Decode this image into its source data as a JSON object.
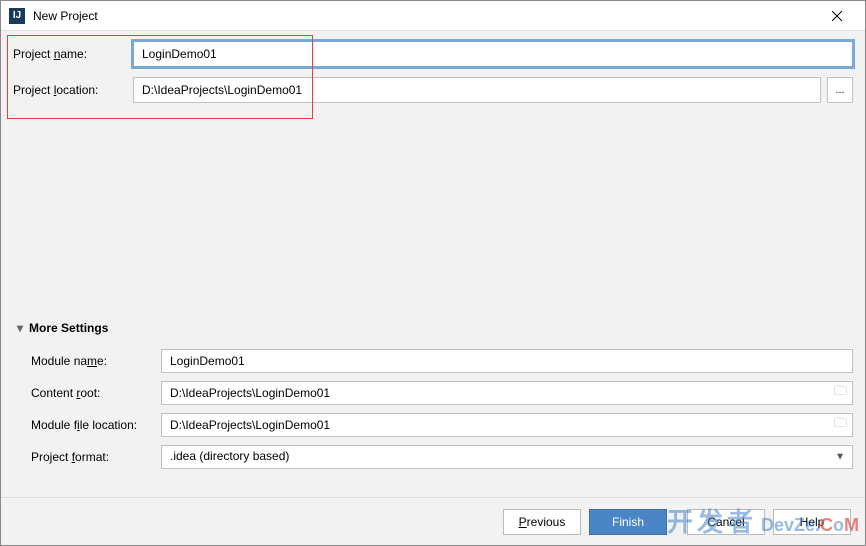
{
  "window": {
    "title": "New Project",
    "icon_glyph": "IJ"
  },
  "form": {
    "project_name_label": "Project name:",
    "project_name_value": "LoginDemo01",
    "project_location_label": "Project location:",
    "project_location_value": "D:\\IdeaProjects\\LoginDemo01",
    "browse_label": "..."
  },
  "more": {
    "header": "More Settings",
    "module_name_label": "Module name:",
    "module_name_value": "LoginDemo01",
    "content_root_label": "Content root:",
    "content_root_value": "D:\\IdeaProjects\\LoginDemo01",
    "module_file_loc_label": "Module file location:",
    "module_file_loc_value": "D:\\IdeaProjects\\LoginDemo01",
    "project_format_label": "Project format:",
    "project_format_value": ".idea (directory based)"
  },
  "buttons": {
    "previous": "Previous",
    "finish": "Finish",
    "cancel": "Cancel",
    "help": "Help"
  },
  "watermark": {
    "cn": "开发者",
    "en": "DevZe.CoM"
  }
}
